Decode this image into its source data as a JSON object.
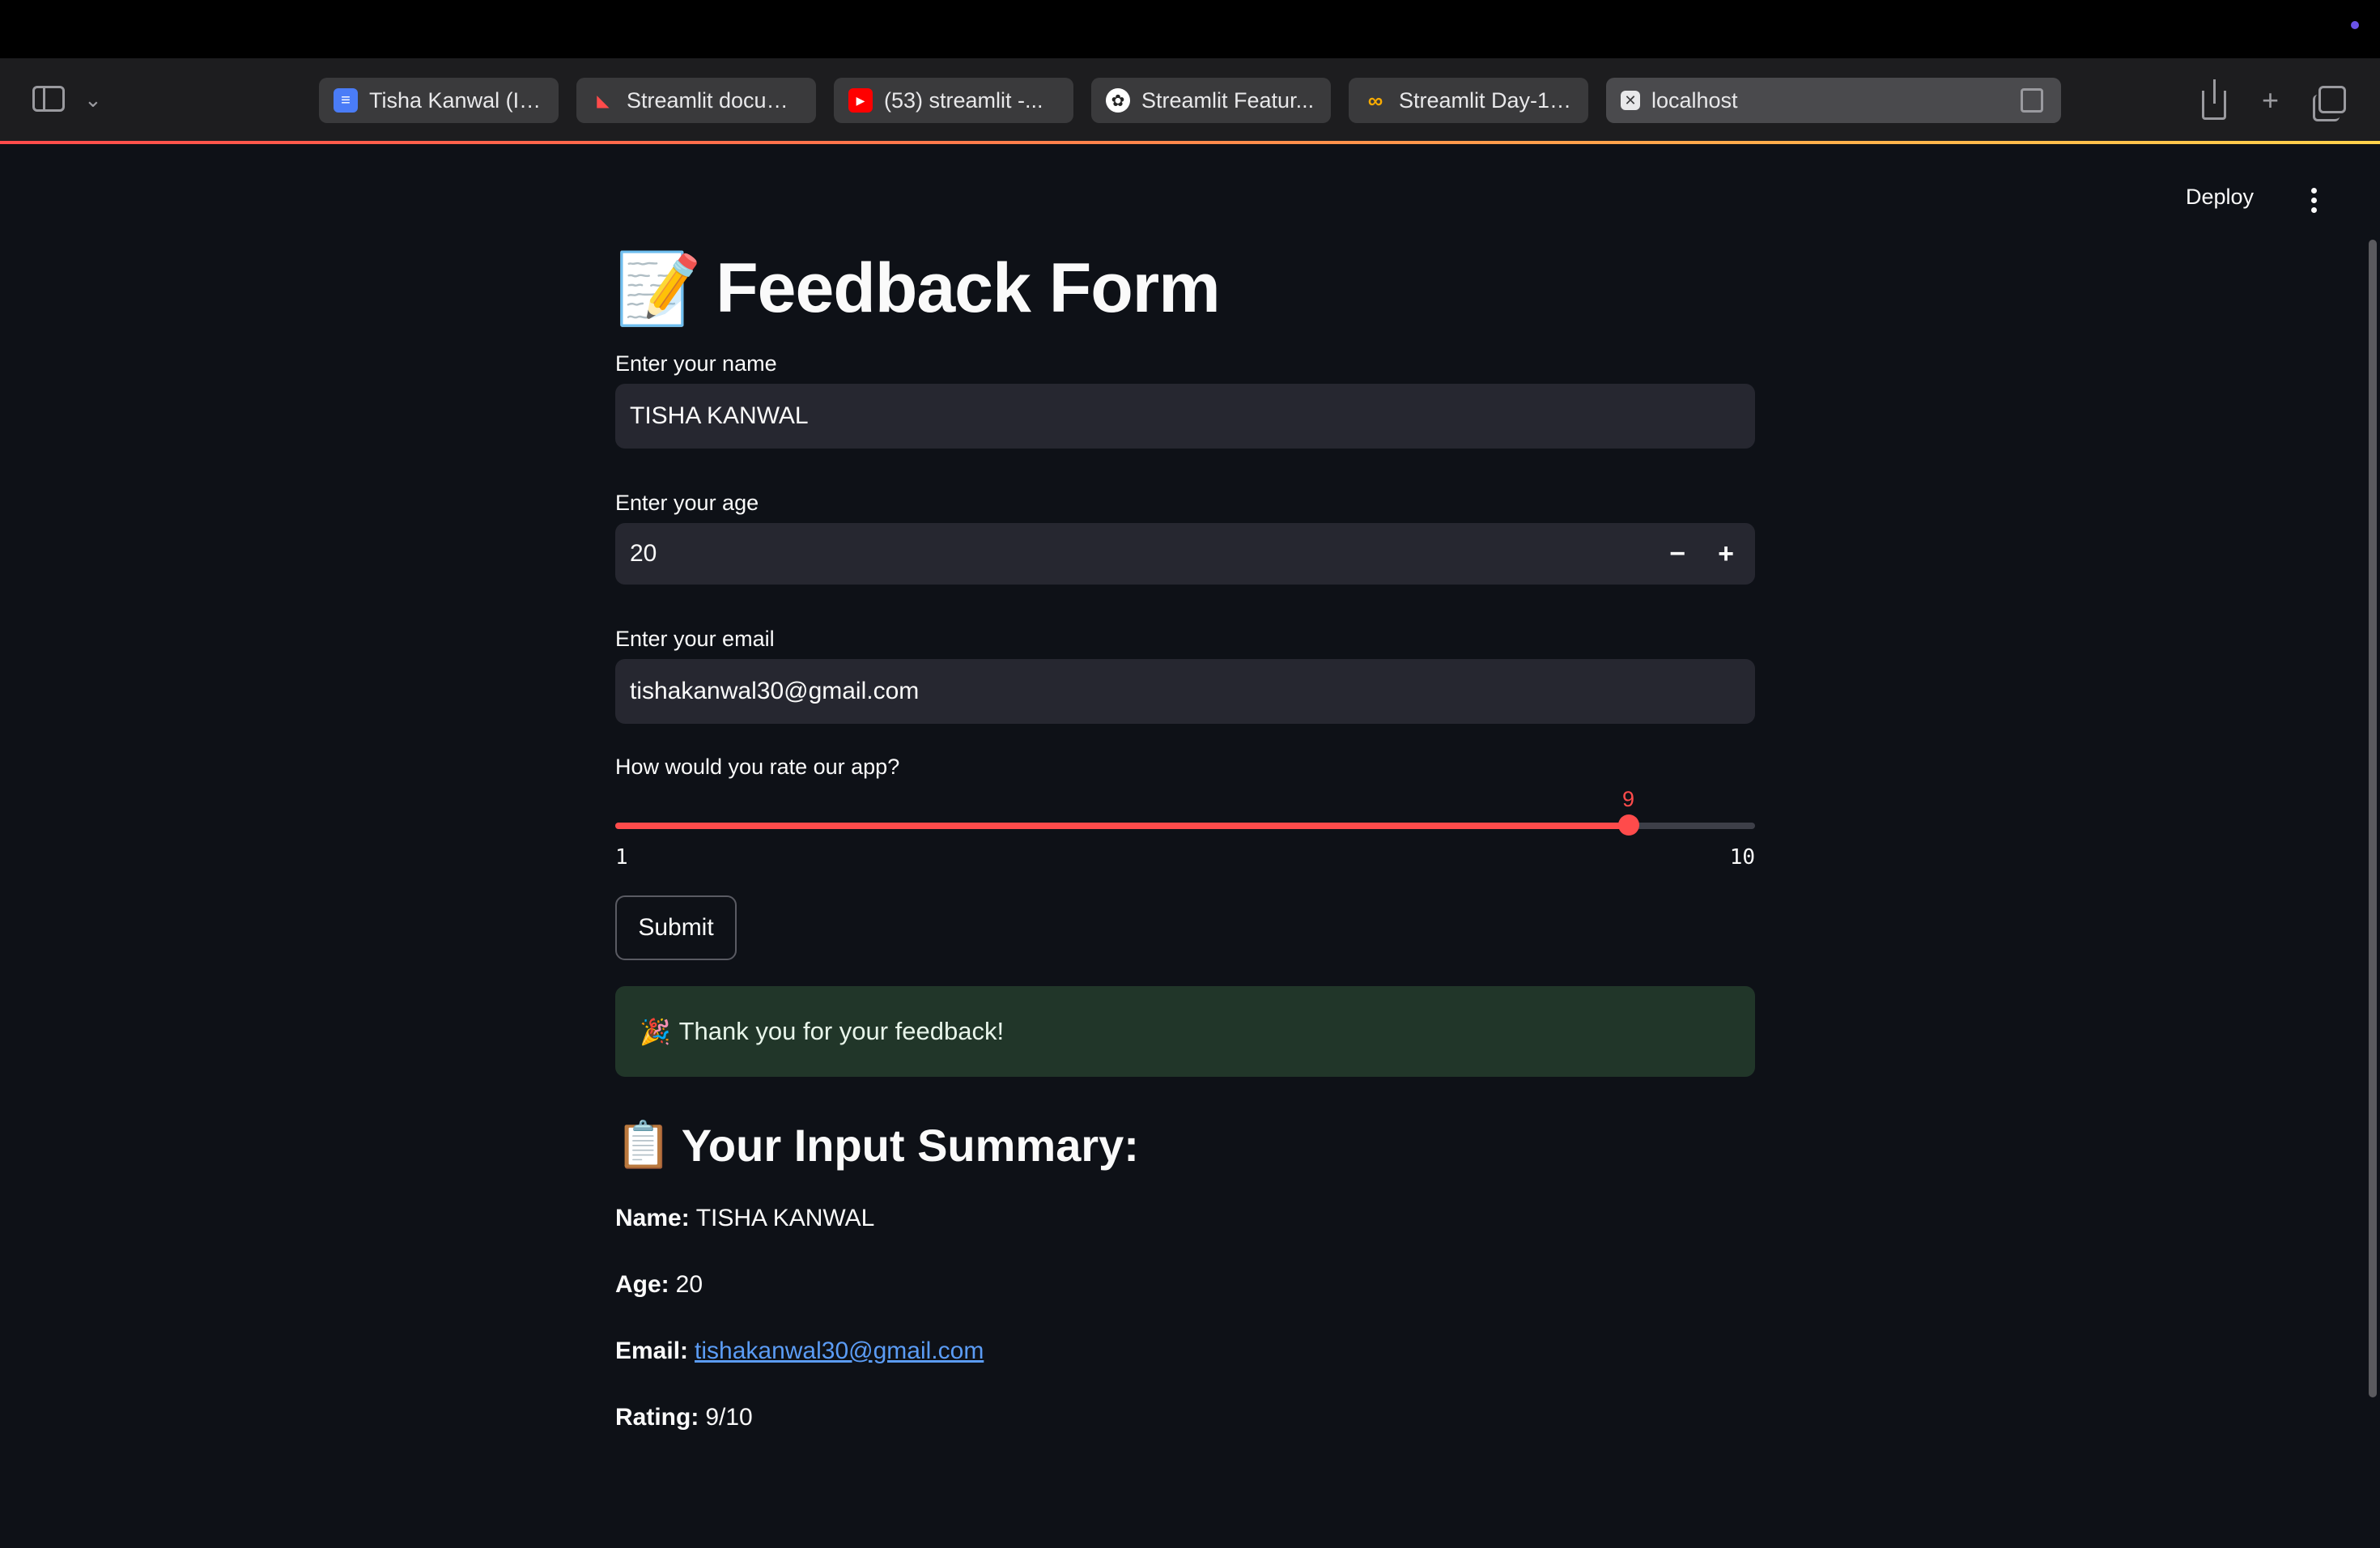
{
  "browser": {
    "tabs": [
      {
        "label": "Tisha Kanwal (In...",
        "icon": "docs-icon",
        "icon_color": "#4a7cf7"
      },
      {
        "label": "Streamlit docum...",
        "icon": "streamlit-icon",
        "icon_color": "#ff4b4b"
      },
      {
        "label": "(53) streamlit -...",
        "icon": "youtube-icon",
        "icon_color": "#ff0000"
      },
      {
        "label": "Streamlit Featur...",
        "icon": "chatgpt-icon",
        "icon_color": "#ffffff"
      },
      {
        "label": "Streamlit Day-1.i...",
        "icon": "colab-icon",
        "icon_color": "#f9ab00"
      },
      {
        "label": "localhost",
        "icon": "close-icon",
        "icon_color": "#e8e8ea",
        "active": true
      }
    ]
  },
  "app": {
    "deploy_label": "Deploy",
    "title_emoji": "📝",
    "title": "Feedback Form",
    "form": {
      "name_label": "Enter your name",
      "name_value": "TISHA KANWAL",
      "age_label": "Enter your age",
      "age_value": "20",
      "age_minus": "−",
      "age_plus": "+",
      "email_label": "Enter your email",
      "email_value": "tishakanwal30@gmail.com",
      "rating_label": "How would you rate our app?",
      "rating_value": 9,
      "rating_value_text": "9",
      "rating_min": "1",
      "rating_max": "10",
      "submit_label": "Submit"
    },
    "success_emoji": "🎉",
    "success_message": "Thank you for your feedback!",
    "summary": {
      "emoji": "📋",
      "heading": "Your Input Summary:",
      "name_key": "Name:",
      "name_value": "TISHA KANWAL",
      "age_key": "Age:",
      "age_value": "20",
      "email_key": "Email:",
      "email_value": "tishakanwal30@gmail.com",
      "rating_key": "Rating:",
      "rating_value": "9/10"
    }
  },
  "colors": {
    "accent": "#ff4b4b",
    "background": "#0e1117",
    "input_bg": "#262730",
    "success_bg": "#213629",
    "link": "#5b9cf5"
  }
}
